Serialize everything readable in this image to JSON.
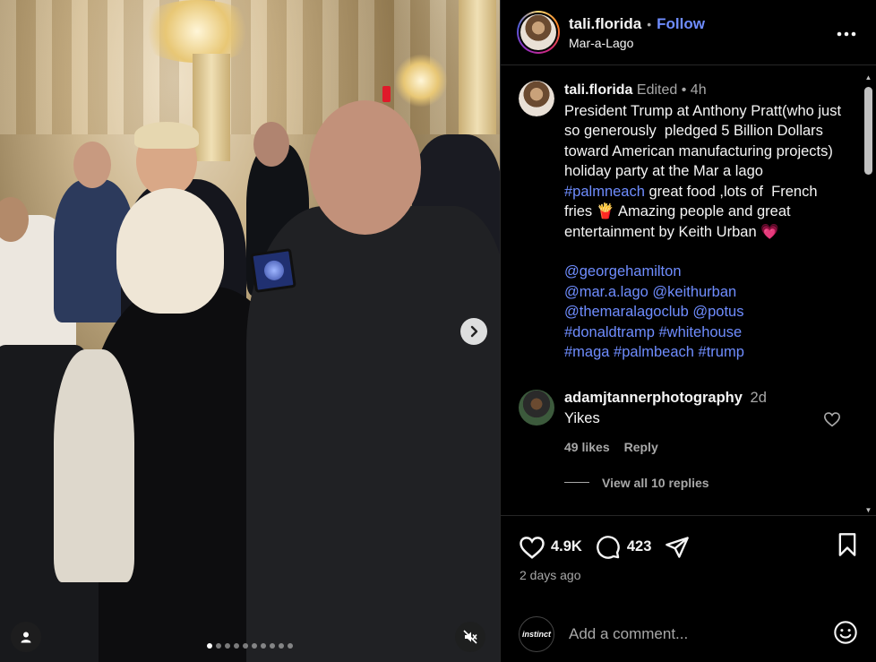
{
  "media": {
    "carousel_dots": 10,
    "active_dot": 0
  },
  "header": {
    "username": "tali.florida",
    "separator": "•",
    "follow_label": "Follow",
    "location": "Mar-a-Lago",
    "more_label": "•••"
  },
  "post": {
    "username": "tali.florida",
    "edited": "Edited",
    "separator": "•",
    "time": "4h",
    "caption_part1": "President Trump at Anthony Pratt(who just so generously  pledged 5 Billion Dollars toward American manufacturing projects) holiday party at the Mar a lago ",
    "caption_hashtag": "#palmneach",
    "caption_part2": " great food ,lots of  French fries 🍟 Amazing people and great entertainment by Keith Urban 💗",
    "tags": [
      "@georgehamilton",
      "@mar.a.lago",
      "@keithurban",
      "@themaralagoclub",
      "@potus",
      "#donaldtramp",
      "#whitehouse",
      "#maga",
      "#palmbeach",
      "#trump"
    ]
  },
  "comment": {
    "username": "adamjtannerphotography",
    "time": "2d",
    "text": "Yikes",
    "likes": "49 likes",
    "reply_label": "Reply",
    "view_replies": "View all 10 replies"
  },
  "actions": {
    "likes": "4.9K",
    "comments": "423",
    "posted_ago": "2 days ago"
  },
  "comment_bar": {
    "avatar_text": "instinct",
    "placeholder": "Add a comment..."
  },
  "colors": {
    "link": "#6f8dff",
    "secondary_text": "#a8a8a8",
    "border": "#262626"
  },
  "icons": [
    "user-icon",
    "next-arrow-icon",
    "mute-icon",
    "more-icon",
    "heart-icon",
    "comment-icon",
    "share-icon",
    "bookmark-icon",
    "emoji-icon"
  ]
}
